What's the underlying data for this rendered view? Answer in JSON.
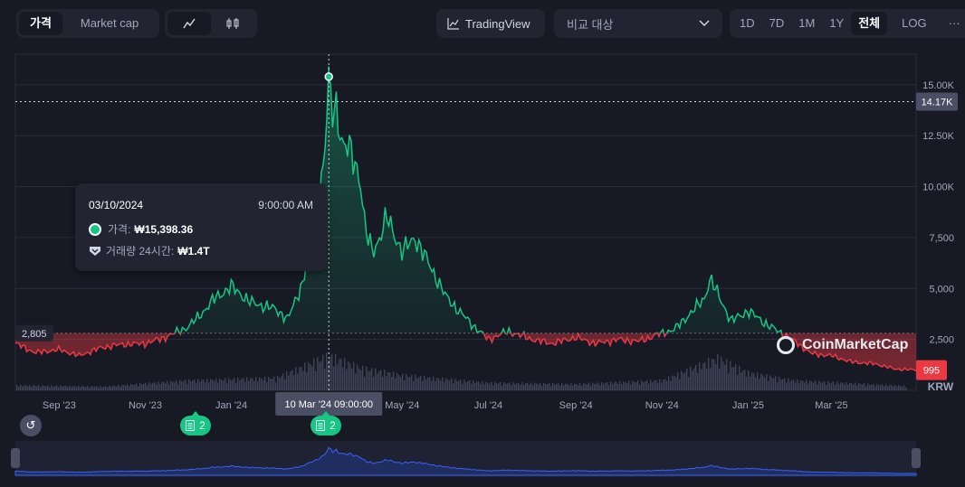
{
  "toolbar": {
    "tabs": [
      "가격",
      "Market cap"
    ],
    "active_tab": 0,
    "chart_type_icons": [
      "line-chart-icon",
      "candlestick-icon"
    ],
    "tradingview_label": "TradingView",
    "compare_placeholder": "비교 대상",
    "ranges": [
      "1D",
      "7D",
      "1M",
      "1Y",
      "전체"
    ],
    "active_range": "전체",
    "log_label": "LOG",
    "more_label": "···"
  },
  "tooltip": {
    "date": "03/10/2024",
    "time": "9:00:00 AM",
    "price_label": "가격:",
    "price_value": "₩15,398.36",
    "volume_label": "거래량 24시간:",
    "volume_value": "₩1.4T"
  },
  "crosshair": {
    "price_tag": "14.17K",
    "date_tag": "10 Mar '24 09:00:00"
  },
  "baseline_label": "2,805",
  "current_price_tag": "995",
  "currency": "KRW",
  "watermark": "CoinMarketCap",
  "events": [
    {
      "label": "2"
    },
    {
      "label": "2"
    }
  ],
  "colors": {
    "up": "#16c784",
    "down": "#ea3943",
    "background": "#171924",
    "volume": "#4a4f63",
    "navigator": "#3861fb"
  },
  "chart_data": {
    "type": "area",
    "y_axis": {
      "ticks": [
        2500,
        5000,
        7500,
        10000,
        12500,
        15000
      ],
      "tick_labels": [
        "2,500",
        "5,000",
        "7,500",
        "10.00K",
        "12.50K",
        "15.00K"
      ],
      "ylim": [
        0,
        16500
      ]
    },
    "x_axis": {
      "tick_labels": [
        "Sep '23",
        "Nov '23",
        "Jan '24",
        "Mar '24",
        "May '24",
        "Jul '24",
        "Sep '24",
        "Nov '24",
        "Jan '25",
        "Mar '25"
      ],
      "range": [
        "2023-08-01",
        "2025-04-30"
      ]
    },
    "baseline": 2805,
    "crosshair_date": "2024-03-10",
    "series": [
      {
        "name": "가격",
        "x": [
          "2023-08-01",
          "2023-08-15",
          "2023-09-01",
          "2023-09-15",
          "2023-10-01",
          "2023-10-15",
          "2023-11-01",
          "2023-11-15",
          "2023-12-01",
          "2023-12-10",
          "2023-12-20",
          "2024-01-01",
          "2024-01-15",
          "2024-02-01",
          "2024-02-10",
          "2024-02-20",
          "2024-03-01",
          "2024-03-05",
          "2024-03-08",
          "2024-03-10",
          "2024-03-12",
          "2024-03-15",
          "2024-03-20",
          "2024-03-25",
          "2024-04-01",
          "2024-04-05",
          "2024-04-10",
          "2024-04-15",
          "2024-04-20",
          "2024-05-01",
          "2024-05-10",
          "2024-05-20",
          "2024-06-01",
          "2024-06-10",
          "2024-06-20",
          "2024-07-01",
          "2024-07-15",
          "2024-08-01",
          "2024-08-15",
          "2024-09-01",
          "2024-09-15",
          "2024-10-01",
          "2024-10-15",
          "2024-11-01",
          "2024-11-10",
          "2024-11-20",
          "2024-12-01",
          "2024-12-05",
          "2024-12-10",
          "2024-12-20",
          "2025-01-01",
          "2025-01-15",
          "2025-02-01",
          "2025-02-15",
          "2025-03-01",
          "2025-03-15",
          "2025-04-01",
          "2025-04-15",
          "2025-04-30"
        ],
        "values": [
          2300,
          1850,
          2000,
          1700,
          2100,
          2250,
          2300,
          2600,
          3100,
          3700,
          4500,
          5100,
          4300,
          4000,
          3500,
          5200,
          8500,
          10500,
          12500,
          15398,
          13500,
          14000,
          12000,
          11800,
          10500,
          7800,
          6800,
          7500,
          8500,
          6800,
          7500,
          6200,
          4600,
          3900,
          3200,
          2500,
          2900,
          2500,
          2300,
          2600,
          2300,
          2500,
          2400,
          2800,
          3000,
          3700,
          4500,
          5500,
          4800,
          3400,
          3900,
          3200,
          2500,
          1800,
          1700,
          1400,
          1300,
          1050,
          995
        ]
      },
      {
        "name": "거래량 24시간",
        "x": [
          "2023-08-01",
          "2023-10-01",
          "2023-12-01",
          "2024-02-01",
          "2024-03-10",
          "2024-04-01",
          "2024-05-01",
          "2024-07-01",
          "2024-09-01",
          "2024-11-01",
          "2024-12-10",
          "2025-01-01",
          "2025-02-01",
          "2025-04-30"
        ],
        "values_trillion_krw": [
          0.2,
          0.15,
          0.4,
          0.5,
          1.4,
          0.9,
          0.6,
          0.3,
          0.25,
          0.4,
          1.3,
          0.7,
          0.4,
          0.15
        ]
      }
    ]
  }
}
